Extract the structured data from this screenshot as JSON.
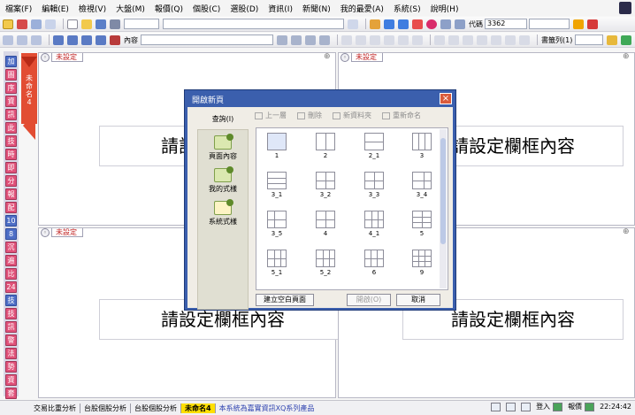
{
  "menu": [
    "檔案(F)",
    "編輯(E)",
    "檢視(V)",
    "大盤(M)",
    "報價(Q)",
    "個股(C)",
    "選股(D)",
    "資訊(I)",
    "新聞(N)",
    "我的最愛(A)",
    "系統(S)",
    "說明(H)"
  ],
  "toolbar1": {
    "code_label": "代碼",
    "code_value": "3362"
  },
  "toolbar2": {
    "content_label": "內容",
    "book_label": "書籤列(1)"
  },
  "sidebar_left": [
    "加",
    "圖",
    "序",
    "資",
    "訊",
    "此",
    "技",
    "時",
    "即",
    "分",
    "報",
    "配",
    "10",
    "8",
    "沉",
    "遍",
    "比",
    "24",
    "技",
    "技",
    "訊",
    "警",
    "法",
    "勢",
    "資",
    "套"
  ],
  "red_tab": {
    "text": "未命名4"
  },
  "panels": [
    {
      "tab": "未設定",
      "placeholder": "請設定欄框內容"
    },
    {
      "tab": "未設定",
      "placeholder": "請設定欄框內容"
    },
    {
      "tab": "未設定",
      "placeholder": "請設定欄框內容"
    },
    {
      "tab": "",
      "placeholder": "請設定欄框內容"
    }
  ],
  "dialog": {
    "title": "開啟新頁",
    "close_glyph": "×",
    "left_heading": "查詢(I)",
    "nav": [
      "頁面內容",
      "我的式樣",
      "系統式樣"
    ],
    "tools": [
      "上一層",
      "刪除",
      "新資料夾",
      "重新命名"
    ],
    "layouts": [
      "1",
      "2",
      "2_1",
      "3",
      "3_1",
      "3_2",
      "3_3",
      "3_4",
      "3_5",
      "4",
      "4_1",
      "5",
      "5_1",
      "5_2",
      "6",
      "9"
    ],
    "buttons": {
      "create": "建立空白頁面",
      "open": "開啟(O)",
      "cancel": "取消"
    }
  },
  "bottom_tabs": [
    "交易比重分析",
    "台股個股分析",
    "台股個股分析",
    "未命名4"
  ],
  "active_tab": "未命名4",
  "scroll_message": "本系統為嘉實資訊XQ系列產品",
  "status": {
    "login": "登入",
    "quote": "報價",
    "time": "22:24:42"
  }
}
